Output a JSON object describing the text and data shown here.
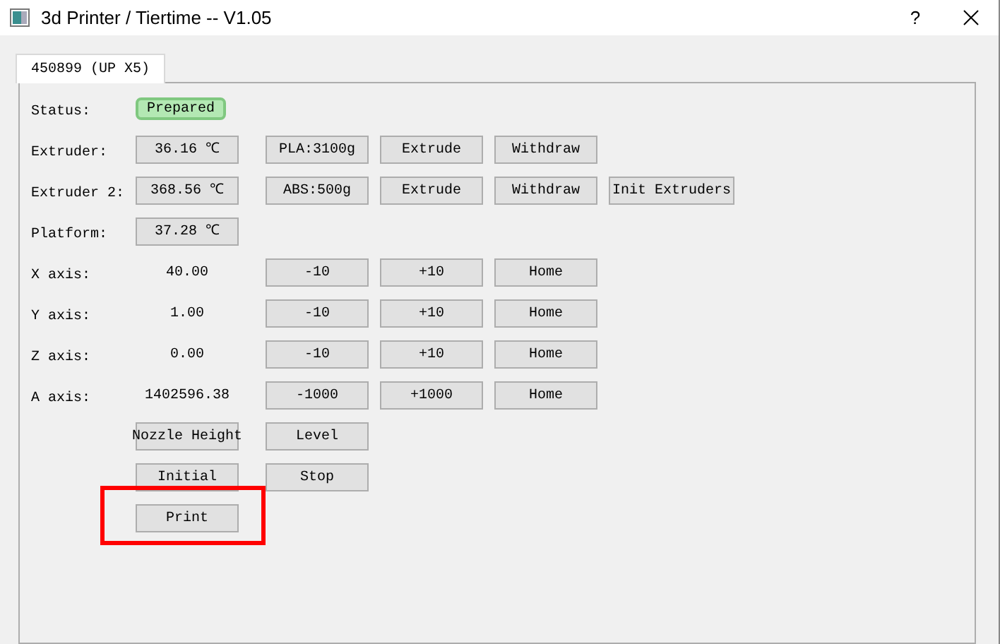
{
  "window": {
    "title": "3d Printer / Tiertime -- V1.05",
    "help": "?"
  },
  "tabs": [
    {
      "label": "450899 (UP X5)",
      "selected": true
    }
  ],
  "rows": [
    {
      "label": "Status:",
      "value": {
        "kind": "status",
        "text": "Prepared"
      },
      "buttons": []
    },
    {
      "label": "Extruder:",
      "value": {
        "kind": "field",
        "text": "36.16 ℃"
      },
      "buttons": [
        "PLA:3100g",
        "Extrude",
        "Withdraw"
      ]
    },
    {
      "label": "Extruder 2:",
      "value": {
        "kind": "field",
        "text": "368.56 ℃"
      },
      "buttons": [
        "ABS:500g",
        "Extrude",
        "Withdraw",
        "Init Extruders"
      ]
    },
    {
      "label": "Platform:",
      "value": {
        "kind": "field",
        "text": "37.28 ℃"
      },
      "buttons": []
    },
    {
      "label": "X axis:",
      "value": {
        "kind": "text",
        "text": "40.00"
      },
      "buttons": [
        "-10",
        "+10",
        "Home"
      ]
    },
    {
      "label": "Y axis:",
      "value": {
        "kind": "text",
        "text": "1.00"
      },
      "buttons": [
        "-10",
        "+10",
        "Home"
      ]
    },
    {
      "label": "Z axis:",
      "value": {
        "kind": "text",
        "text": "0.00"
      },
      "buttons": [
        "-10",
        "+10",
        "Home"
      ]
    },
    {
      "label": "A axis:",
      "value": {
        "kind": "text",
        "text": "1402596.38"
      },
      "buttons": [
        "-1000",
        "+1000",
        "Home"
      ]
    },
    {
      "value": {
        "kind": "button",
        "text": "Nozzle Height",
        "highlighted": false
      },
      "buttons": [
        "Level"
      ]
    },
    {
      "value": {
        "kind": "button",
        "text": "Initial",
        "highlighted": false
      },
      "buttons": [
        "Stop"
      ]
    },
    {
      "value": {
        "kind": "button",
        "text": "Print",
        "highlighted": true
      },
      "buttons": []
    }
  ]
}
